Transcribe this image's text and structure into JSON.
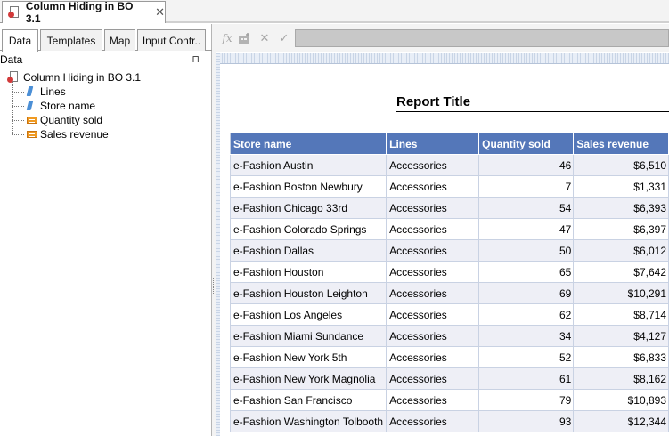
{
  "doc_tab": {
    "title": "Column Hiding in BO 3.1",
    "close": "✕"
  },
  "left_panel": {
    "tabs": [
      "Data",
      "Templates",
      "Map",
      "Input Contr.."
    ],
    "header": "Data",
    "pin": "⊓",
    "tree": {
      "root": "Column Hiding in BO 3.1",
      "children": [
        {
          "label": "Lines",
          "icon": "dimension-icon"
        },
        {
          "label": "Store name",
          "icon": "dimension-icon"
        },
        {
          "label": "Quantity sold",
          "icon": "measure-icon"
        },
        {
          "label": "Sales revenue",
          "icon": "measure-icon"
        }
      ]
    }
  },
  "formula_bar": {
    "fx": "fx",
    "cancel": "✕",
    "validate": "✓"
  },
  "report": {
    "title": "Report Title",
    "columns": [
      "Store name",
      "Lines",
      "Quantity sold",
      "Sales revenue"
    ],
    "rows": [
      [
        "e-Fashion Austin",
        "Accessories",
        "46",
        "$6,510"
      ],
      [
        "e-Fashion Boston Newbury",
        "Accessories",
        "7",
        "$1,331"
      ],
      [
        "e-Fashion Chicago 33rd",
        "Accessories",
        "54",
        "$6,393"
      ],
      [
        "e-Fashion Colorado Springs",
        "Accessories",
        "47",
        "$6,397"
      ],
      [
        "e-Fashion Dallas",
        "Accessories",
        "50",
        "$6,012"
      ],
      [
        "e-Fashion Houston",
        "Accessories",
        "65",
        "$7,642"
      ],
      [
        "e-Fashion Houston Leighton",
        "Accessories",
        "69",
        "$10,291"
      ],
      [
        "e-Fashion Los Angeles",
        "Accessories",
        "62",
        "$8,714"
      ],
      [
        "e-Fashion Miami Sundance",
        "Accessories",
        "34",
        "$4,127"
      ],
      [
        "e-Fashion New York 5th",
        "Accessories",
        "52",
        "$6,833"
      ],
      [
        "e-Fashion New York Magnolia",
        "Accessories",
        "61",
        "$8,162"
      ],
      [
        "e-Fashion San Francisco",
        "Accessories",
        "79",
        "$10,893"
      ],
      [
        "e-Fashion Washington Tolbooth",
        "Accessories",
        "93",
        "$12,344"
      ]
    ]
  }
}
